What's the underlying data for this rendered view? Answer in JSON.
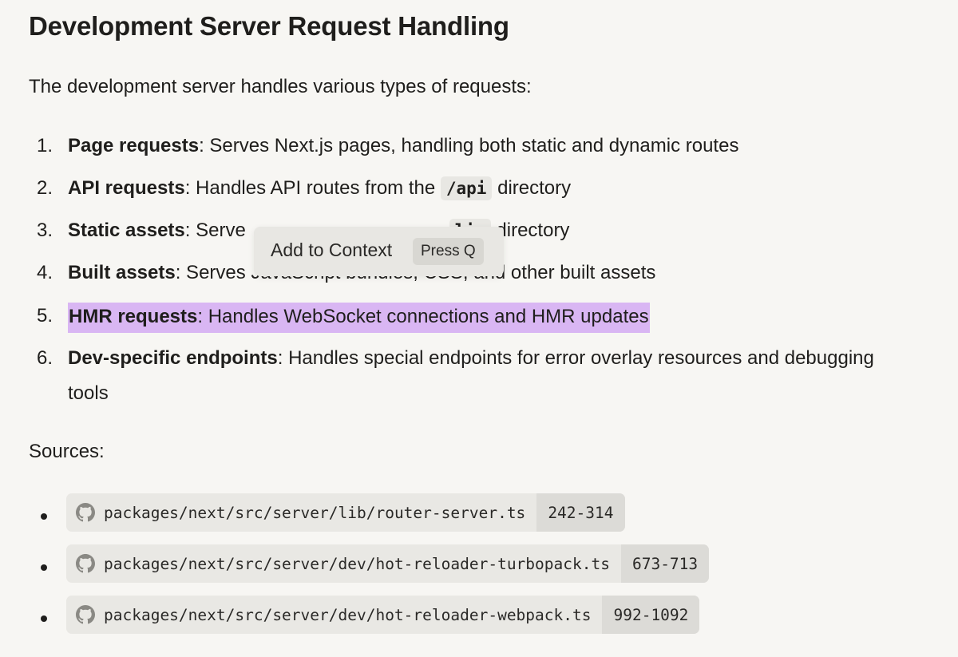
{
  "heading": "Development Server Request Handling",
  "intro": "The development server handles various types of requests:",
  "requests": [
    {
      "num": "1.",
      "bold": "Page requests",
      "text": ": Serves Next.js pages, handling both static and dynamic routes"
    },
    {
      "num": "2.",
      "bold": "API requests",
      "text_before": ": Handles API routes from the ",
      "code": "/api",
      "text_after": " directory"
    },
    {
      "num": "3.",
      "bold": "Static assets",
      "text_before": ": Serve",
      "code": "lic",
      "text_after": " directory"
    },
    {
      "num": "4.",
      "bold": "Built assets",
      "text": ": Serves JavaScript bundles, CSS, and other built assets"
    },
    {
      "num": "5.",
      "bold": "HMR requests",
      "text": ": Handles WebSocket connections and HMR updates",
      "highlighted": true
    },
    {
      "num": "6.",
      "bold": "Dev-specific endpoints",
      "text": ": Handles special endpoints for error overlay resources and debugging",
      "text_wrap": "tools"
    }
  ],
  "popup": {
    "label": "Add to Context",
    "key_hint": "Press Q"
  },
  "sources_label": "Sources:",
  "sources": [
    {
      "path": "packages/next/src/server/lib/router-server.ts",
      "lines": "242-314",
      "icon": "github-icon"
    },
    {
      "path": "packages/next/src/server/dev/hot-reloader-turbopack.ts",
      "lines": "673-713",
      "icon": "github-icon"
    },
    {
      "path": "packages/next/src/server/dev/hot-reloader-webpack.ts",
      "lines": "992-1092",
      "icon": "github-icon"
    }
  ],
  "colors": {
    "highlight": "#d9b6f3",
    "background": "#f7f6f3",
    "chip": "#e9e8e4"
  }
}
